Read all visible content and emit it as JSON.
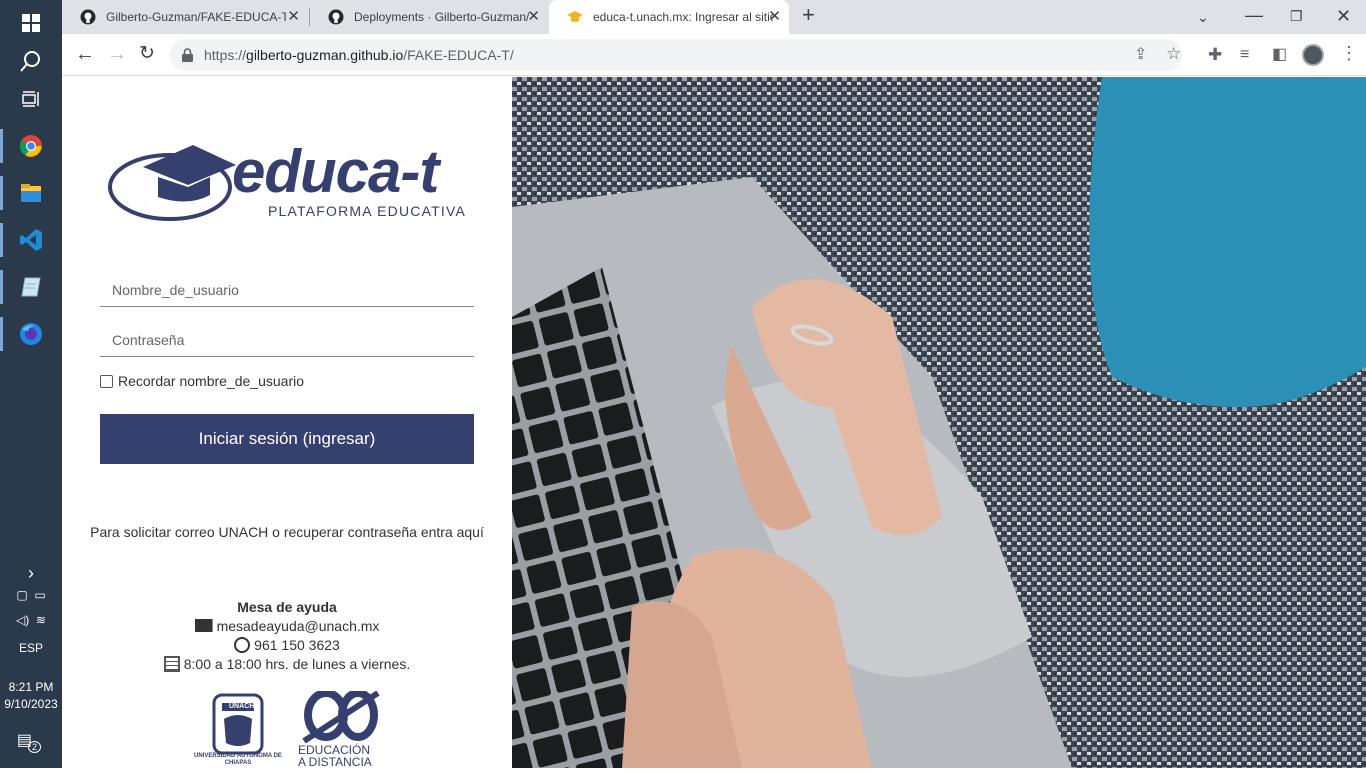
{
  "taskbar": {
    "apps": [
      "windows-start",
      "search",
      "task-view",
      "chrome",
      "file-explorer",
      "vscode",
      "notepad",
      "firefox"
    ],
    "language": "ESP",
    "time": "8:21 PM",
    "date": "9/10/2023",
    "notifications": "2"
  },
  "browser": {
    "tabs": [
      {
        "title": "Gilberto-Guzman/FAKE-EDUCA-T"
      },
      {
        "title": "Deployments · Gilberto-Guzman/"
      },
      {
        "title": "educa-t.unach.mx: Ingresar al sitio"
      }
    ],
    "url_prefix": "https://",
    "url_host": "gilberto-guzman.github.io",
    "url_path": "/FAKE-EDUCA-T/"
  },
  "login": {
    "logo_title": "educa-t",
    "logo_subtitle": "PLATAFORMA EDUCATIVA",
    "username_placeholder": "Nombre_de_usuario",
    "password_placeholder": "Contraseña",
    "remember_label": "Recordar nombre_de_usuario",
    "submit_label": "Iniciar sesión (ingresar)",
    "help_text": "Para solicitar correo UNACH o recuperar contraseña entra aquí",
    "helpdesk_title": "Mesa de ayuda",
    "email": "mesadeayuda@unach.mx",
    "phone": "961 150 3623",
    "hours": "8:00 a 18:00 hrs. de lunes a viernes.",
    "unach_logo_text": "UNIVERSIDAD AUTÓNOMA DE CHIAPAS",
    "unach_seal": "UNACH",
    "distance_logo_line1": "EDUCACIÓN",
    "distance_logo_line2": "A DISTANCIA"
  },
  "colors": {
    "brand": "#35406e",
    "taskbar": "#2b3a4a"
  }
}
